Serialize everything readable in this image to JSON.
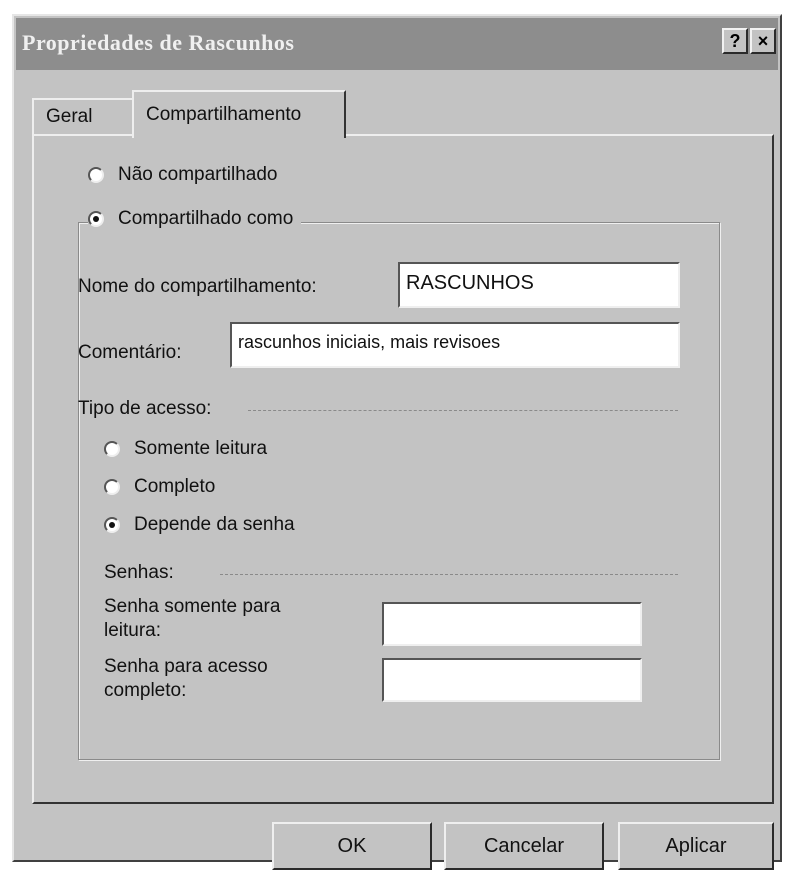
{
  "window": {
    "title": "Propriedades de Rascunhos",
    "help_button": "?",
    "close_button": "×"
  },
  "tabs": [
    {
      "label": "Geral",
      "active": false
    },
    {
      "label": "Compartilhamento",
      "active": true
    }
  ],
  "sharing": {
    "not_shared_label": "Não compartilhado",
    "shared_as_label": "Compartilhado como",
    "selected": "shared_as"
  },
  "share_name": {
    "label": "Nome do compartilhamento:",
    "value": "RASCUNHOS"
  },
  "comment": {
    "label": "Comentário:",
    "value": "rascunhos iniciais, mais revisoes"
  },
  "access_type": {
    "label": "Tipo de acesso:",
    "options": [
      {
        "label": "Somente leitura",
        "checked": false
      },
      {
        "label": "Completo",
        "checked": false
      },
      {
        "label": "Depende da senha",
        "checked": true
      }
    ]
  },
  "passwords": {
    "label": "Senhas:",
    "readonly_label_line1": "Senha somente para",
    "readonly_label_line2": "leitura:",
    "readonly_value": "",
    "full_label_line1": "Senha para acesso",
    "full_label_line2": "completo:",
    "full_value": ""
  },
  "buttons": {
    "ok": "OK",
    "cancel": "Cancelar",
    "apply": "Aplicar"
  },
  "colors": {
    "dialog_face": "#c3c3c3",
    "titlebar": "#8d8d8d",
    "field_background": "#ffffff"
  }
}
